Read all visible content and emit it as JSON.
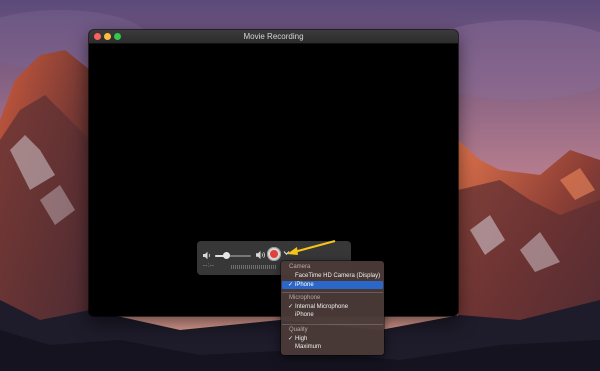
{
  "window": {
    "title": "Movie Recording"
  },
  "controller": {
    "time_display": "--:--",
    "volume_level": 0.3,
    "record_button_color": "#e2403a"
  },
  "record_menu": {
    "sections": [
      {
        "header": "Camera",
        "items": [
          {
            "label": "FaceTime HD Camera (Display)",
            "checked": false,
            "highlighted": false
          },
          {
            "label": "iPhone",
            "checked": true,
            "highlighted": true
          }
        ]
      },
      {
        "header": "Microphone",
        "items": [
          {
            "label": "Internal Microphone",
            "checked": true,
            "highlighted": false
          },
          {
            "label": "iPhone",
            "checked": false,
            "highlighted": false
          }
        ]
      },
      {
        "header": "Quality",
        "items": [
          {
            "label": "High",
            "checked": true,
            "highlighted": false
          },
          {
            "label": "Maximum",
            "checked": false,
            "highlighted": false
          }
        ]
      }
    ],
    "check_glyph": "✓"
  },
  "annotation": {
    "arrow_color": "#f5c518"
  },
  "colors": {
    "selection_blue": "#2b66c9"
  }
}
